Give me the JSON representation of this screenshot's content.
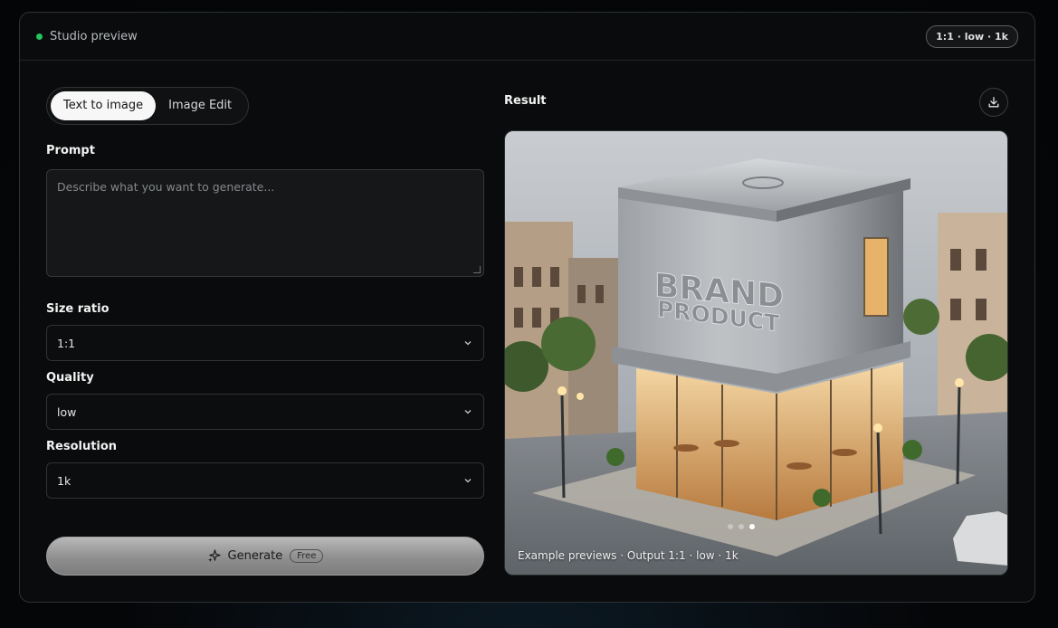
{
  "header": {
    "title": "Studio preview",
    "status_color": "#22c55e",
    "spec_badge": "1:1 · low · 1k"
  },
  "mode": {
    "tabs": [
      {
        "label": "Text to image",
        "active": true
      },
      {
        "label": "Image Edit",
        "active": false
      }
    ]
  },
  "prompt": {
    "label": "Prompt",
    "placeholder": "Describe what you want to generate..."
  },
  "fields": {
    "size_ratio": {
      "label": "Size ratio",
      "value": "1:1"
    },
    "quality": {
      "label": "Quality",
      "value": "low"
    },
    "resolution": {
      "label": "Resolution",
      "value": "1k"
    }
  },
  "generate": {
    "label": "Generate",
    "badge": "Free",
    "icon": "sparkle-icon"
  },
  "result": {
    "label": "Result",
    "download_icon": "download-icon",
    "image_sign_line1": "BRAND",
    "image_sign_line2": "PRODUCT",
    "caption": "Example previews · Output 1:1 · low · 1k",
    "carousel_total": 3,
    "carousel_active_index": 2
  }
}
